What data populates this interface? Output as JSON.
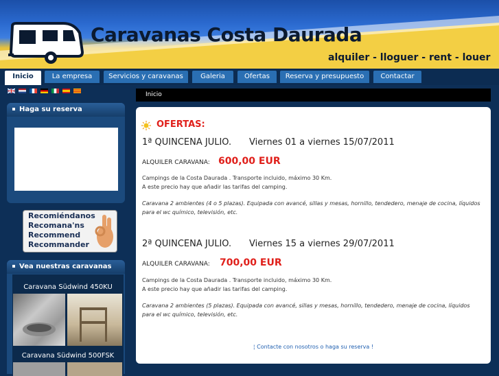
{
  "header": {
    "site_title": "Caravanas Costa Daurada",
    "tagline": "alquiler - lloguer - rent - louer",
    "logo_icon": "caravan-icon"
  },
  "nav": {
    "tabs": [
      {
        "label": "Inicio",
        "active": true
      },
      {
        "label": "La empresa"
      },
      {
        "label": "Servicios y caravanas"
      },
      {
        "label": "Galeria"
      },
      {
        "label": "Ofertas"
      },
      {
        "label": "Reserva y presupuesto"
      },
      {
        "label": "Contactar"
      }
    ]
  },
  "languages": [
    "english-flag-icon",
    "dutch-flag-icon",
    "french-flag-icon",
    "german-flag-icon",
    "italian-flag-icon",
    "spanish-flag-icon",
    "catalan-flag-icon"
  ],
  "breadcrumb": "Inicio",
  "sidebar": {
    "booking_title": "Haga su reserva",
    "recommend": [
      "Recomiéndanos",
      "Recomana'ns",
      "Recommend",
      "Recommander"
    ],
    "caravans_title": "Vea nuestras caravanas",
    "caravans": [
      {
        "name": "Caravana Südwind 450KU"
      },
      {
        "name": "Caravana Südwind 500FSK"
      }
    ]
  },
  "main": {
    "offers_title": "OFERTAS:",
    "offers": [
      {
        "period": "1ª QUINCENA JULIO.",
        "dates": "Viernes 01 a viernes 15/07/2011",
        "price_label": "ALQUILER CARAVANA:",
        "price": "600,00 EUR",
        "line1": "Campings de la Costa Daurada . Transporte incluido, máximo 30 Km.",
        "line2": "A este precio hay que añadir las tarifas del camping.",
        "description": "Caravana 2 ambientes (4 o 5 plazas). Equipada con avancé, sillas y mesas, hornillo, tendedero, menaje de cocina, líquidos para el wc químico, televisión, etc."
      },
      {
        "period": "2ª QUINCENA JULIO.",
        "dates": "Viernes 15 a viernes 29/07/2011",
        "price_label": "ALQUILER CARAVANA:",
        "price": "700,00 EUR",
        "line1": "Campings de la Costa Daurada . Transporte incluido, máximo 30 Km.",
        "line2": "A este precio hay que añadir las tarifas del camping.",
        "description": "Caravana 2 ambientes (5 plazas). Equipada con avancé, sillas y mesas, hornillo, tendedero, menaje de cocina, líquidos para el wc químico, televisión, etc."
      }
    ],
    "contact_text": "¦ Contacte con nosotros o haga su reserva  !"
  },
  "colors": {
    "accent_red": "#e0201b",
    "nav_tab": "#2a6fb3",
    "page_bg": "#0d2f57"
  }
}
